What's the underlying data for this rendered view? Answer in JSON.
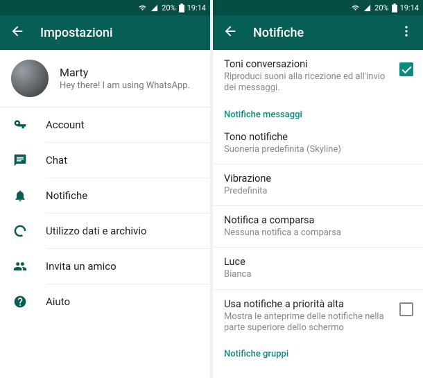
{
  "status": {
    "battery_pct": "20%",
    "time": "19:14"
  },
  "left": {
    "title": "Impostazioni",
    "profile": {
      "name": "Marty",
      "status": "Hey there! I am using WhatsApp."
    },
    "items": [
      {
        "icon": "key",
        "label": "Account"
      },
      {
        "icon": "chat",
        "label": "Chat"
      },
      {
        "icon": "bell",
        "label": "Notifiche"
      },
      {
        "icon": "data",
        "label": "Utilizzo dati e archivio"
      },
      {
        "icon": "invite",
        "label": "Invita un amico"
      },
      {
        "icon": "help",
        "label": "Aiuto"
      }
    ]
  },
  "right": {
    "title": "Notifiche",
    "rows": {
      "conv": {
        "title": "Toni conversazioni",
        "sub": "Riproduci suoni alla ricezione ed all'invio dei messaggi.",
        "checked": true
      },
      "section_messages": "Notifiche messaggi",
      "tone": {
        "title": "Tono notifiche",
        "sub": "Suoneria predefinita (Skyline)"
      },
      "vibration": {
        "title": "Vibrazione",
        "sub": "Predefinita"
      },
      "popup": {
        "title": "Notifica a comparsa",
        "sub": "Nessuna notifica a comparsa"
      },
      "light": {
        "title": "Luce",
        "sub": "Bianca"
      },
      "priority": {
        "title": "Usa notifiche a priorità alta",
        "sub": "Mostra le anteprime delle notifiche nella parte superiore dello schermo",
        "checked": false
      },
      "section_groups": "Notifiche gruppi"
    }
  }
}
